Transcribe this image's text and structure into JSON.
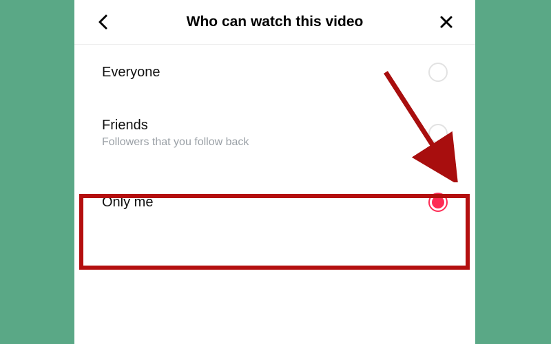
{
  "header": {
    "title": "Who can watch this video"
  },
  "options": [
    {
      "label": "Everyone",
      "sublabel": "",
      "selected": false
    },
    {
      "label": "Friends",
      "sublabel": "Followers that you follow back",
      "selected": false
    },
    {
      "label": "Only me",
      "sublabel": "",
      "selected": true
    }
  ],
  "annotation": {
    "highlight_target": "option-only-me",
    "arrow_to": "radio-only-me"
  }
}
